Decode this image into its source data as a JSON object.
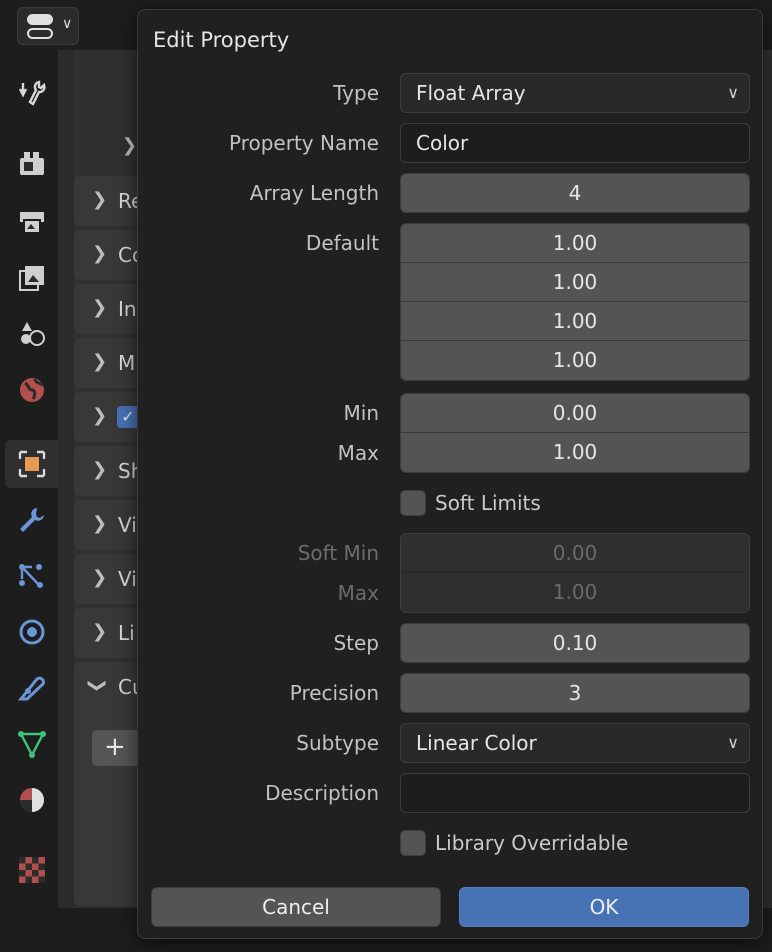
{
  "dialog": {
    "title": "Edit Property",
    "type": {
      "label": "Type",
      "value": "Float Array"
    },
    "property_name": {
      "label": "Property Name",
      "value": "Color"
    },
    "array_length": {
      "label": "Array Length",
      "value": "4"
    },
    "default": {
      "label": "Default",
      "values": [
        "1.00",
        "1.00",
        "1.00",
        "1.00"
      ]
    },
    "min": {
      "label": "Min",
      "value": "0.00"
    },
    "max": {
      "label": "Max",
      "value": "1.00"
    },
    "soft_limits": {
      "label": "Soft Limits",
      "checked": false
    },
    "soft_min": {
      "label": "Soft Min",
      "value": "0.00"
    },
    "soft_max": {
      "label": "Max",
      "value": "1.00"
    },
    "step": {
      "label": "Step",
      "value": "0.10"
    },
    "precision": {
      "label": "Precision",
      "value": "3"
    },
    "subtype": {
      "label": "Subtype",
      "value": "Linear Color"
    },
    "description": {
      "label": "Description",
      "value": ""
    },
    "library_overridable": {
      "label": "Library Overridable",
      "checked": false
    },
    "cancel_label": "Cancel",
    "ok_label": "OK"
  },
  "background": {
    "panels": [
      {
        "label": "Re",
        "expanded": false
      },
      {
        "label": "Co",
        "expanded": false
      },
      {
        "label": "In",
        "expanded": false
      },
      {
        "label": "M",
        "expanded": false
      },
      {
        "label": "",
        "expanded": false,
        "checkbox": true
      },
      {
        "label": "Sh",
        "expanded": false
      },
      {
        "label": "Vi",
        "expanded": false
      },
      {
        "label": "Vi",
        "expanded": false
      },
      {
        "label": "Li",
        "expanded": false
      },
      {
        "label": "Cu",
        "expanded": true
      }
    ],
    "tabs": [
      "tool",
      "render",
      "output",
      "view-layer",
      "scene",
      "world",
      "object",
      "modifiers",
      "particles",
      "physics",
      "constraints",
      "data",
      "material",
      "texture"
    ]
  },
  "colors": {
    "accent": "#4772b3",
    "field": "#545454",
    "dialog_bg": "#202020"
  }
}
